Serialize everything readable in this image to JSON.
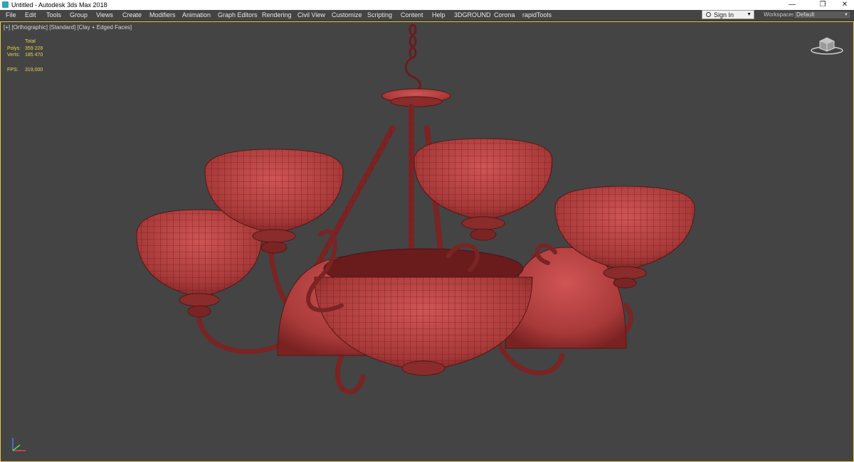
{
  "window": {
    "title": "Untitled - Autodesk 3ds Max 2018",
    "controls": {
      "minimize": "—",
      "maximize": "❐",
      "close": "✕"
    }
  },
  "menu": {
    "items": [
      "File",
      "Edit",
      "Tools",
      "Group",
      "Views",
      "Create",
      "Modifiers",
      "Animation",
      "Graph Editors",
      "Rendering",
      "Civil View",
      "Customize",
      "Scripting",
      "Content",
      "Help",
      "3DGROUND",
      "Corona",
      "rapidTools"
    ]
  },
  "account": {
    "sign_in_label": "Sign In",
    "workspaces_label": "Workspaces:",
    "workspace_value": "Default"
  },
  "viewport": {
    "label": "[+] [Orthographic] [Standard] [Clay + Edged Faces]",
    "stats": {
      "total_label": "Total",
      "polys_label": "Polys:",
      "polys_value": "359 228",
      "verts_label": "Verts:",
      "verts_value": "185 470",
      "fps_label": "FPS:",
      "fps_value": "319,000"
    },
    "colors": {
      "border": "#e8c84a",
      "stats_text": "#e6d54a",
      "mesh": "#a93a3a",
      "background": "#444444"
    }
  },
  "icons": {
    "app": "3ds-max-app-icon",
    "viewcube": "viewcube-icon",
    "axis": "axis-tripod-icon",
    "user": "user-icon"
  }
}
